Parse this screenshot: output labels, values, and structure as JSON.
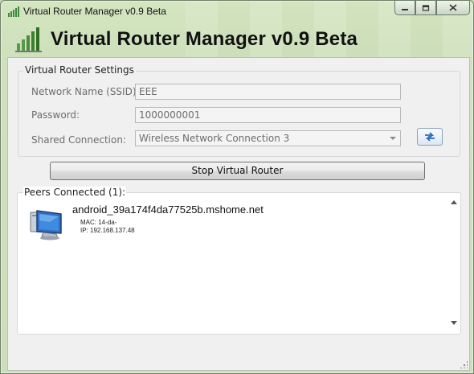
{
  "window": {
    "title": "Virtual Router Manager v0.9 Beta",
    "minimize_icon": "minimize-icon",
    "maximize_icon": "restore-icon",
    "close_icon": "close-icon"
  },
  "header": {
    "title": "Virtual Router Manager v0.9 Beta",
    "icon": "signal-bars-icon"
  },
  "settings": {
    "legend": "Virtual Router Settings",
    "ssid_label": "Network Name (SSID):",
    "ssid_value": "EEE",
    "password_label": "Password:",
    "password_value": "1000000001",
    "shared_label": "Shared Connection:",
    "shared_value": "Wireless Network Connection 3",
    "refresh_icon": "refresh-icon"
  },
  "actions": {
    "stop_label": "Stop Virtual Router"
  },
  "peers": {
    "legend": "Peers Connected (1):",
    "items": [
      {
        "name": "android_39a174f4da77525b.mshome.net",
        "mac": "MAC: 14-da-",
        "ip": "IP: 192.168.137.48",
        "icon": "computer-monitor-icon"
      }
    ]
  },
  "colors": {
    "accent": "#2d6db5",
    "frame": "#cfe1bc"
  }
}
